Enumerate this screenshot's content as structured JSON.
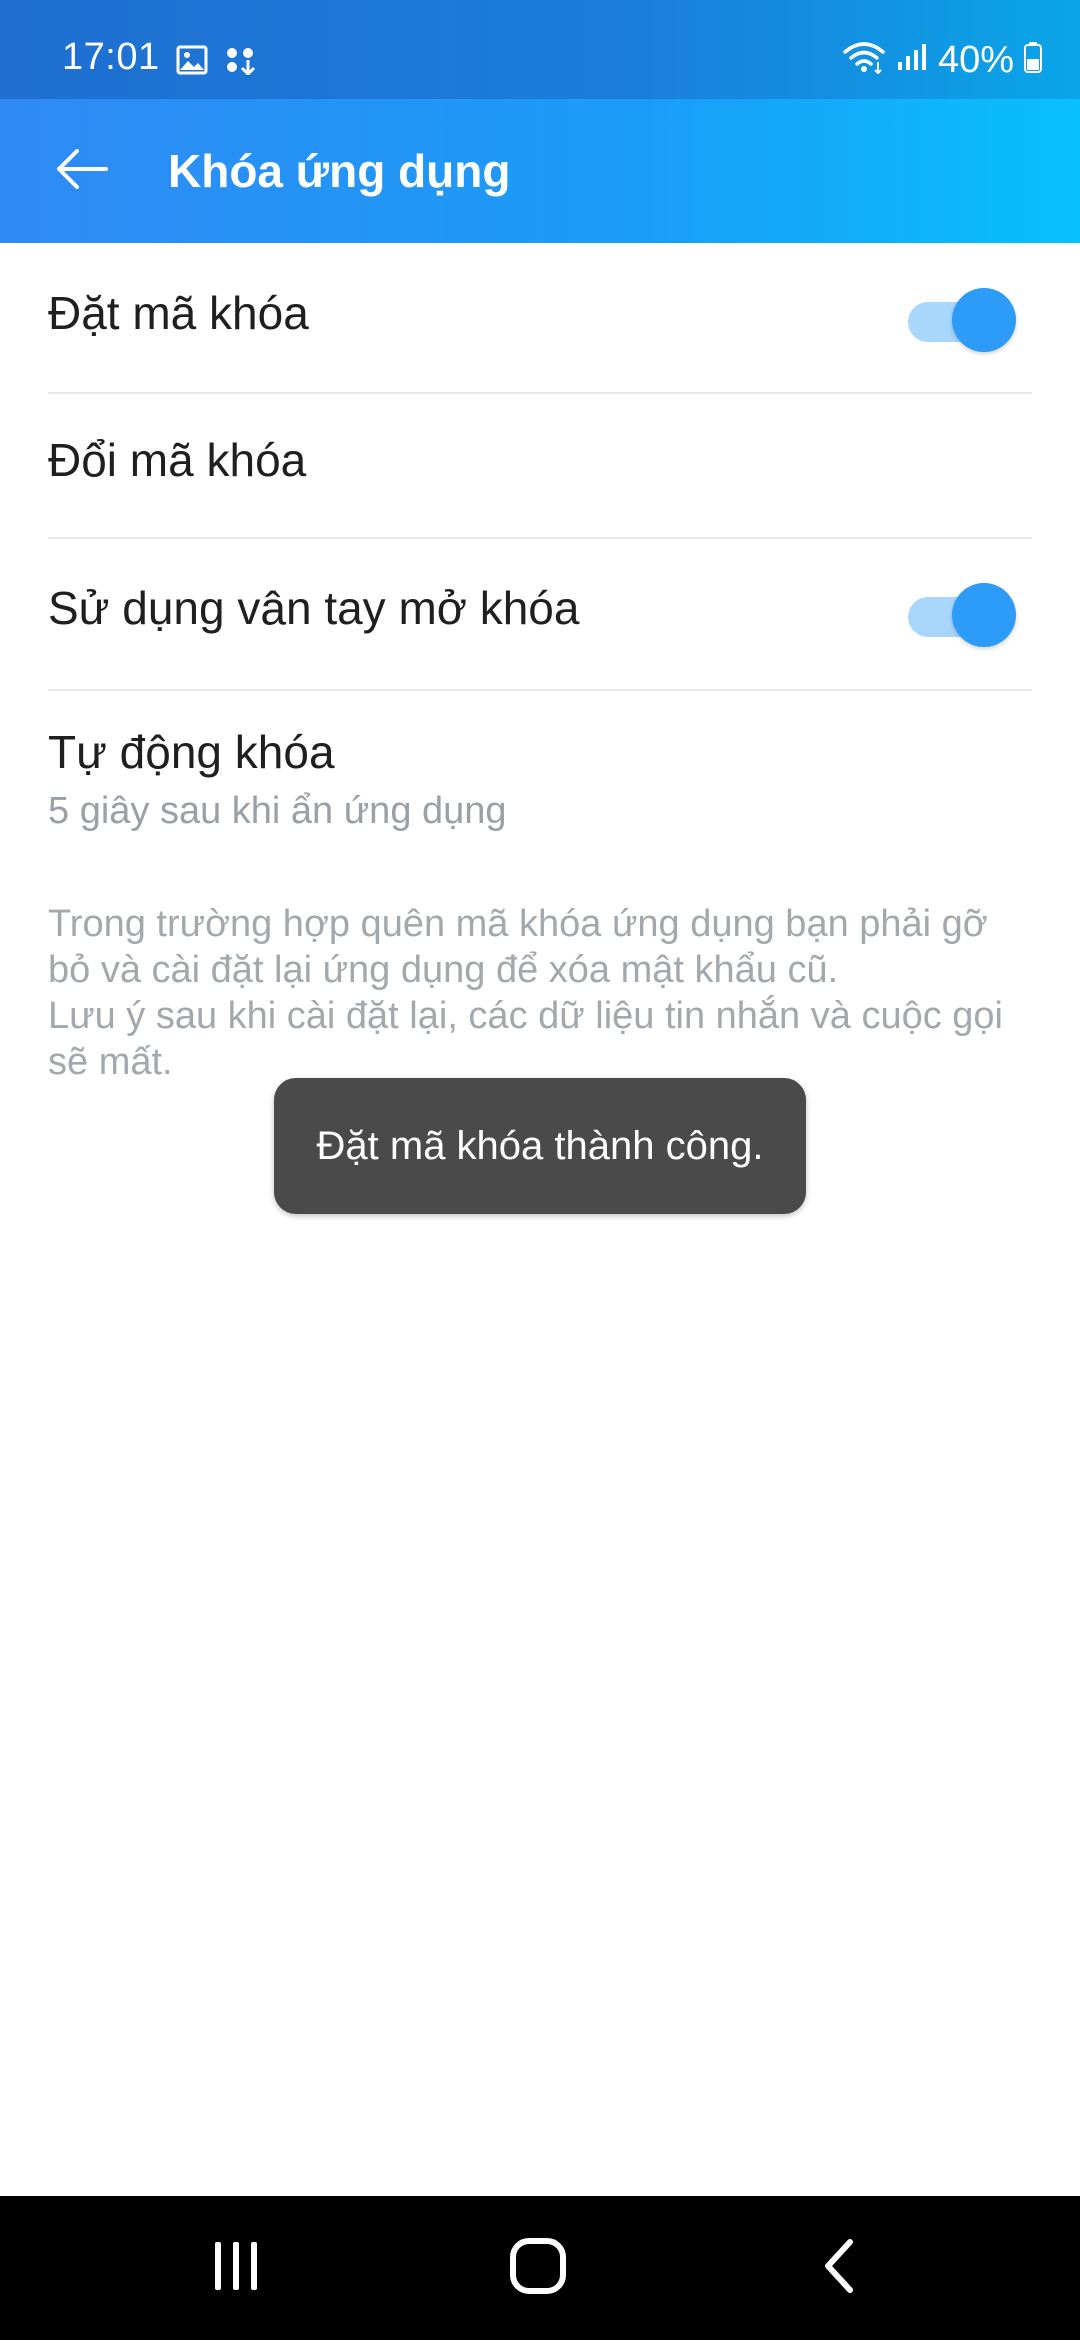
{
  "status_bar": {
    "time": "17:01",
    "battery": "40%",
    "icons": [
      "image-icon",
      "game-launcher-icon",
      "wifi-icon",
      "signal-icon",
      "battery-icon"
    ]
  },
  "appbar": {
    "title": "Khóa ứng dụng",
    "back_icon": "arrow-left-icon"
  },
  "settings": {
    "set_passcode": {
      "label": "Đặt mã khóa",
      "enabled": true
    },
    "change_passcode": {
      "label": "Đổi mã khóa"
    },
    "fingerprint": {
      "label": "Sử dụng vân tay mở khóa",
      "enabled": true
    },
    "auto_lock": {
      "label": "Tự động khóa",
      "value": "5 giây sau khi ẩn ứng dụng"
    }
  },
  "info_text": "Trong trường hợp quên mã khóa ứng dụng bạn phải gỡ\nbỏ và cài đặt lại ứng dụng để xóa mật khẩu cũ.\nLưu ý sau khi cài đặt lại, các dữ liệu tin nhắn và cuộc gọi\nsẽ mất.",
  "toast": "Đặt mã khóa thành công.",
  "navbar": {
    "icons": [
      "recent-apps-icon",
      "home-icon",
      "back-icon"
    ]
  },
  "colors": {
    "accent": "#2d9bf8",
    "toggle_track": "#a9d6fb",
    "header_start": "#2f8af5",
    "header_end": "#08c0fb"
  }
}
